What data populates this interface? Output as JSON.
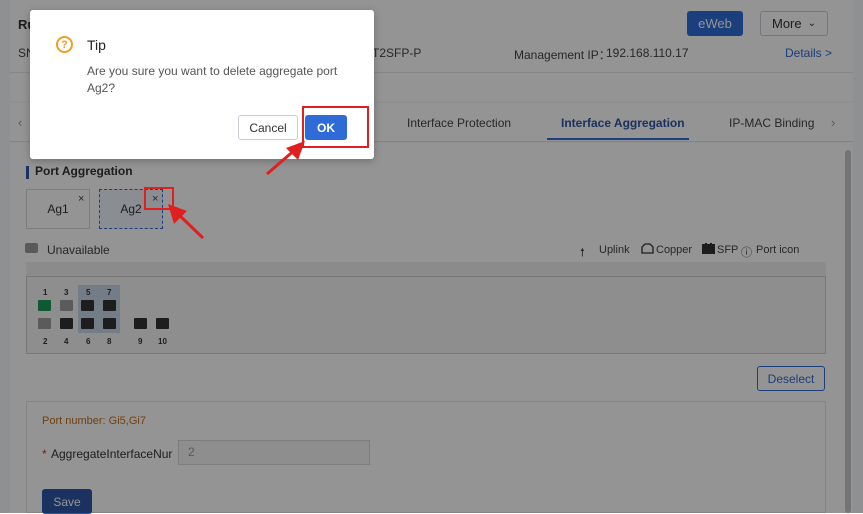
{
  "header": {
    "title": "Ru",
    "sn_prefix": "SN",
    "model_suffix": "T2SFP-P",
    "management_ip_label": "Management IP：",
    "management_ip": "192.168.110.17",
    "details_link": "Details >",
    "eweb_button": "eWeb",
    "more_button": "More"
  },
  "tabs": {
    "prev_arrow": "‹",
    "next_arrow": "›",
    "items": [
      "Interface Protection",
      "Interface Aggregation",
      "IP-MAC Binding"
    ],
    "active": "Interface Aggregation"
  },
  "section": {
    "title": "Port Aggregation",
    "aggregates": [
      "Ag1",
      "Ag2"
    ],
    "remove_glyph": "×"
  },
  "legend": {
    "unavailable": "Unavailable",
    "uplink": "Uplink",
    "copper": "Copper",
    "sfp": "SFP",
    "port_icon": "Port icon"
  },
  "ports": {
    "top_numbers": [
      "1",
      "3",
      "5",
      "7"
    ],
    "bottom_numbers": [
      "2",
      "4",
      "6",
      "8",
      "9",
      "10"
    ]
  },
  "form": {
    "deselect_button": "Deselect",
    "port_number_text": "Port number: Gi5,Gi7",
    "required_mark": "*",
    "field_label": "AggregateInterfaceNur",
    "field_value": "2",
    "save_button": "Save"
  },
  "dialog": {
    "title": "Tip",
    "message": "Are you sure you want to delete aggregate port Ag2?",
    "cancel_button": "Cancel",
    "ok_button": "OK",
    "icon_glyph": "?"
  },
  "colors": {
    "primary": "#2f6bd6",
    "highlight_red": "#e02020",
    "warning": "#f0a020"
  }
}
